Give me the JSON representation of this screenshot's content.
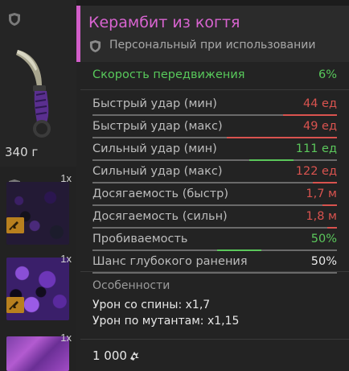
{
  "inventory": {
    "weight": "340 г",
    "slots": [
      {
        "qty": "1x"
      },
      {
        "qty": "1x"
      },
      {
        "qty": "1x"
      }
    ]
  },
  "item": {
    "title": "Керамбит из когтя",
    "subtitle": "Персональный при использовании",
    "speed": {
      "label": "Скорость передвижения",
      "value": "6%"
    },
    "stats": [
      {
        "label": "Быстрый удар (мин)",
        "value": "44 ед",
        "color": "#d9534f",
        "level": 0.78,
        "dir": "down"
      },
      {
        "label": "Быстрый удар (макс)",
        "value": "49 ед",
        "color": "#d9534f",
        "level": 0.55,
        "dir": "down"
      },
      {
        "label": "Сильный удар (мин)",
        "value": "111 ед",
        "color": "#5bc75b",
        "level": 0.82,
        "dir": "up"
      },
      {
        "label": "Сильный удар (макс)",
        "value": "122 ед",
        "color": "#d9534f",
        "level": 0.9,
        "dir": "down"
      },
      {
        "label": "Досягаемость (быстр)",
        "value": "1,7 м",
        "color": "#d9534f",
        "level": 0.94,
        "dir": "down"
      },
      {
        "label": "Досягаемость (сильн)",
        "value": "1,8 м",
        "color": "#d9534f",
        "level": 0.96,
        "dir": "down"
      },
      {
        "label": "Пробиваемость",
        "value": "50%",
        "color": "#5bc75b",
        "level": 0.69,
        "dir": "up"
      },
      {
        "label": "Шанс глубокого ранения",
        "value": "50%",
        "color": "#e8e8e8",
        "level": 1.0,
        "dir": "none"
      }
    ],
    "features": {
      "title": "Особенности",
      "lines": [
        "Урон со спины: x1,7",
        "Урон по мутантам: x1,15"
      ]
    },
    "price": "1 000"
  },
  "colors": {
    "accent": "#d25ec9",
    "positive": "#5bc75b",
    "negative": "#d9534f"
  },
  "icons": [
    "shield-icon",
    "knife-icon",
    "rifle-icon",
    "coin-icon"
  ]
}
